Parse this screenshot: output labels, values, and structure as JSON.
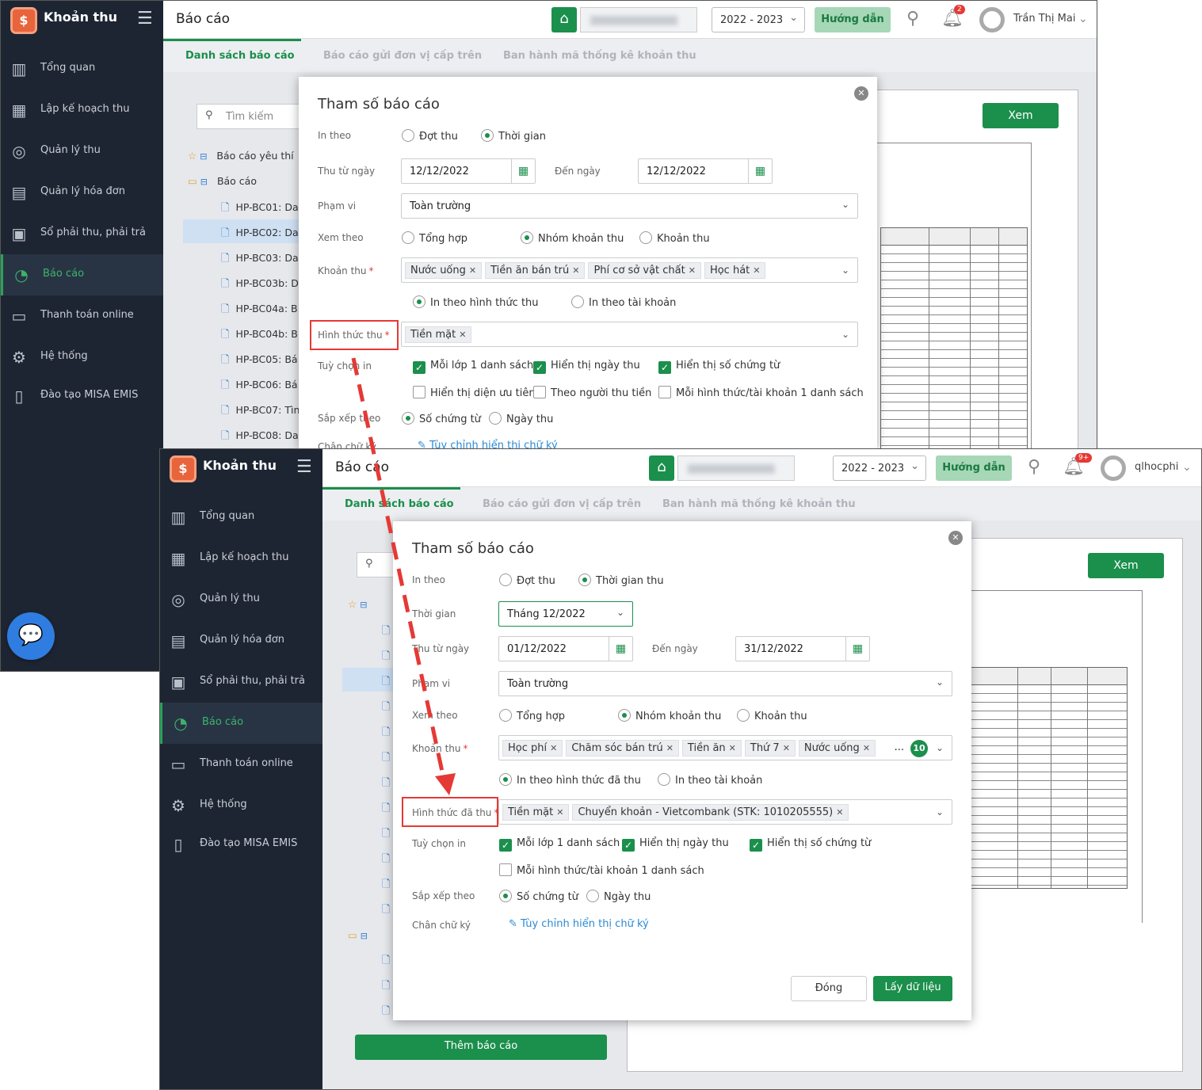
{
  "app_name": "Khoản thu",
  "page_title": "Báo cáo",
  "nav": [
    {
      "icon": "chart-bars-icon",
      "label": "Tổng quan"
    },
    {
      "icon": "calendar-plan-icon",
      "label": "Lập kế hoạch thu"
    },
    {
      "icon": "money-hand-icon",
      "label": "Quản lý thu"
    },
    {
      "icon": "invoice-icon",
      "label": "Quản lý hóa đơn"
    },
    {
      "icon": "ledger-icon",
      "label": "Sổ phải thu, phải trả"
    },
    {
      "icon": "pie-chart-icon",
      "label": "Báo cáo"
    },
    {
      "icon": "online-payment-icon",
      "label": "Thanh toán online"
    },
    {
      "icon": "gear-icon",
      "label": "Hệ thống"
    },
    {
      "icon": "book-icon",
      "label": "Đào tạo MISA EMIS"
    }
  ],
  "header": {
    "school_year": "2022 - 2023",
    "guide_label": "Hướng dẫn"
  },
  "tabs": [
    "Danh sách báo cáo",
    "Báo cáo gửi đơn vị cấp trên",
    "Ban hành mã thống kê khoản thu"
  ],
  "search_placeholder": "Tìm kiếm",
  "view_label": "Xem",
  "add_report_label": "Thêm báo cáo",
  "before": {
    "user_name": "Trần Thị Mai",
    "notification_count": "2",
    "tree_groups": [
      "Báo cáo yêu thí",
      "Báo cáo"
    ],
    "tree_items": [
      "HP-BC01: Da",
      "HP-BC02: Da",
      "HP-BC03: Da",
      "HP-BC03b: D",
      "HP-BC04a: B",
      "HP-BC04b: B",
      "HP-BC05: Bá",
      "HP-BC06: Bá",
      "HP-BC07: Tìn",
      "HP-BC08: Da"
    ],
    "modal": {
      "title": "Tham số báo cáo",
      "in_theo_label": "In theo",
      "in_theo_opt1": "Đợt thu",
      "in_theo_opt2": "Thời gian",
      "from_label": "Thu từ ngày",
      "from_value": "12/12/2022",
      "to_label": "Đến ngày",
      "to_value": "12/12/2022",
      "scope_label": "Phạm vi",
      "scope_value": "Toàn trường",
      "view_by_label": "Xem theo",
      "view_opt1": "Tổng hợp",
      "view_opt2": "Nhóm khoản thu",
      "view_opt3": "Khoản thu",
      "fees_label": "Khoản thu",
      "fees": [
        "Nước uống",
        "Tiền ăn bán trú",
        "Phí cơ sở vật chất",
        "Học hát"
      ],
      "print_opt1": "In theo hình thức thu",
      "print_opt2": "In theo tài khoản",
      "method_label": "Hình thức thu",
      "methods": [
        "Tiền mặt"
      ],
      "options_label": "Tuỳ chọn in",
      "opt_a": "Mỗi lớp 1 danh sách",
      "opt_b": "Hiển thị ngày thu",
      "opt_c": "Hiển thị số chứng từ",
      "opt_d": "Hiển thị diện ưu tiên",
      "opt_e": "Theo người thu tiền",
      "opt_f": "Mỗi hình thức/tài khoản 1 danh sách",
      "sort_label": "Sắp xếp theo",
      "sort_opt1": "Số chứng từ",
      "sort_opt2": "Ngày thu",
      "sign_label": "Chân chữ ký",
      "sign_link": "Tùy chỉnh hiển thị chữ ký"
    }
  },
  "after": {
    "user_name": "qlhocphi",
    "notification_count": "9+",
    "modal": {
      "title": "Tham số báo cáo",
      "in_theo_label": "In theo",
      "in_theo_opt1": "Đợt thu",
      "in_theo_opt2": "Thời gian thu",
      "period_label": "Thời gian",
      "period_value": "Tháng 12/2022",
      "from_label": "Thu từ ngày",
      "from_value": "01/12/2022",
      "to_label": "Đến ngày",
      "to_value": "31/12/2022",
      "scope_label": "Phạm vi",
      "scope_value": "Toàn trường",
      "view_by_label": "Xem theo",
      "view_opt1": "Tổng hợp",
      "view_opt2": "Nhóm khoản thu",
      "view_opt3": "Khoản thu",
      "fees_label": "Khoản thu",
      "fees": [
        "Học phí",
        "Chăm sóc bán trú",
        "Tiền ăn",
        "Thứ 7",
        "Nước uống"
      ],
      "fees_more": "...",
      "fees_count": "10",
      "print_opt1": "In theo hình thức đã thu",
      "print_opt2": "In theo tài khoản",
      "method_label": "Hình thức đã thu",
      "methods": [
        "Tiền mặt",
        "Chuyển khoản - Vietcombank (STK: 1010205555)"
      ],
      "options_label": "Tuỳ chọn in",
      "opt_a": "Mỗi lớp 1 danh sách",
      "opt_b": "Hiển thị ngày thu",
      "opt_c": "Hiển thị số chứng từ",
      "opt_f": "Mỗi hình thức/tài khoản 1 danh sách",
      "sort_label": "Sắp xếp theo",
      "sort_opt1": "Số chứng từ",
      "sort_opt2": "Ngày thu",
      "sign_label": "Chân chữ ký",
      "sign_link": "Tùy chỉnh hiển thị chữ ký",
      "close_label": "Đóng",
      "fetch_label": "Lấy dữ liệu"
    }
  },
  "colors": {
    "accent": "#1b8f4c",
    "sidebar": "#1e2532",
    "highlight": "#e53935"
  }
}
